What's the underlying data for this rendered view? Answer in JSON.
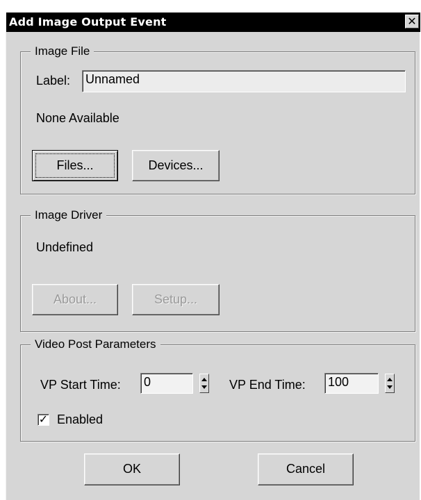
{
  "dialog": {
    "title": "Add Image Output Event",
    "close_glyph": "✕"
  },
  "image_file": {
    "legend": "Image File",
    "label_caption": "Label:",
    "label_value": "Unnamed",
    "status": "None Available",
    "files_button": "Files...",
    "devices_button": "Devices..."
  },
  "image_driver": {
    "legend": "Image Driver",
    "status": "Undefined",
    "about_button": "About...",
    "setup_button": "Setup..."
  },
  "video_post": {
    "legend": "Video Post Parameters",
    "start_caption": "VP Start Time:",
    "start_value": "0",
    "end_caption": "VP End Time:",
    "end_value": "100",
    "enabled_label": "Enabled",
    "enabled_checked": true,
    "check_glyph": "✓"
  },
  "footer": {
    "ok_button": "OK",
    "cancel_button": "Cancel"
  }
}
